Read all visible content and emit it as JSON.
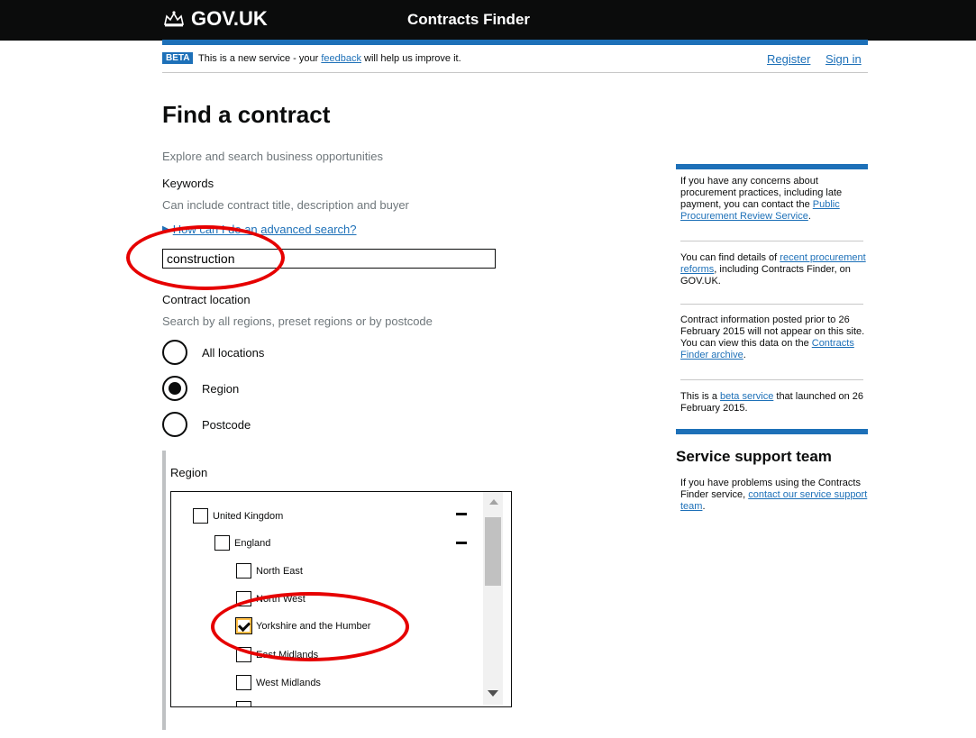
{
  "header": {
    "logo_text": "GOV.UK",
    "logo_icon": "crown-icon",
    "service_name": "Contracts Finder"
  },
  "beta_banner": {
    "tag": "BETA",
    "text_before": "This is a new service - your ",
    "link": "feedback",
    "text_after": " will help us improve it.",
    "register": "Register",
    "sign_in": "Sign in"
  },
  "page_title": "Find a contract",
  "intro": "Explore and search business opportunities",
  "keywords": {
    "label": "Keywords",
    "hint": "Can include contract title, description and buyer",
    "advanced_link": "How can I do an advanced search?",
    "value": "construction"
  },
  "location": {
    "label": "Contract location",
    "hint": "Search by all regions, preset regions or by postcode",
    "options": [
      {
        "label": "All locations",
        "checked": false
      },
      {
        "label": "Region",
        "checked": true
      },
      {
        "label": "Postcode",
        "checked": false
      }
    ]
  },
  "region_panel": {
    "title": "Region",
    "items": [
      {
        "label": "United Kingdom",
        "level": 0,
        "checked": false,
        "expandable": true
      },
      {
        "label": "England",
        "level": 1,
        "checked": false,
        "expandable": true
      },
      {
        "label": "North East",
        "level": 2,
        "checked": false
      },
      {
        "label": "North West",
        "level": 2,
        "checked": false
      },
      {
        "label": "Yorkshire and the Humber",
        "level": 2,
        "checked": true
      },
      {
        "label": "East Midlands",
        "level": 2,
        "checked": false
      },
      {
        "label": "West Midlands",
        "level": 2,
        "checked": false
      }
    ]
  },
  "sidebar": {
    "p1_text": "If you have any concerns about procurement practices, including late payment, you can contact the ",
    "p1_link": "Public Procurement Review Service",
    "p1_end": ".",
    "p2_text": "You can find details of ",
    "p2_link": "recent procurement reforms",
    "p2_end": ", including Contracts Finder, on GOV.UK.",
    "p3_text": "Contract information posted prior to 26 February 2015 will not appear on this site. You can view this data on the ",
    "p3_link": "Contracts Finder archive",
    "p3_end": ".",
    "p4_text": "This is a ",
    "p4_link": "beta service",
    "p4_end": " that launched on 26 February 2015.",
    "support_title": "Service support team",
    "support_text": "If you have problems using the Contracts Finder service, ",
    "support_link": "contact our service support team",
    "support_end": "."
  },
  "colors": {
    "brand_blue": "#1d70b8",
    "header_black": "#0b0c0c",
    "annotation_red": "#e60000",
    "focus_yellow": "#ffbf47"
  }
}
